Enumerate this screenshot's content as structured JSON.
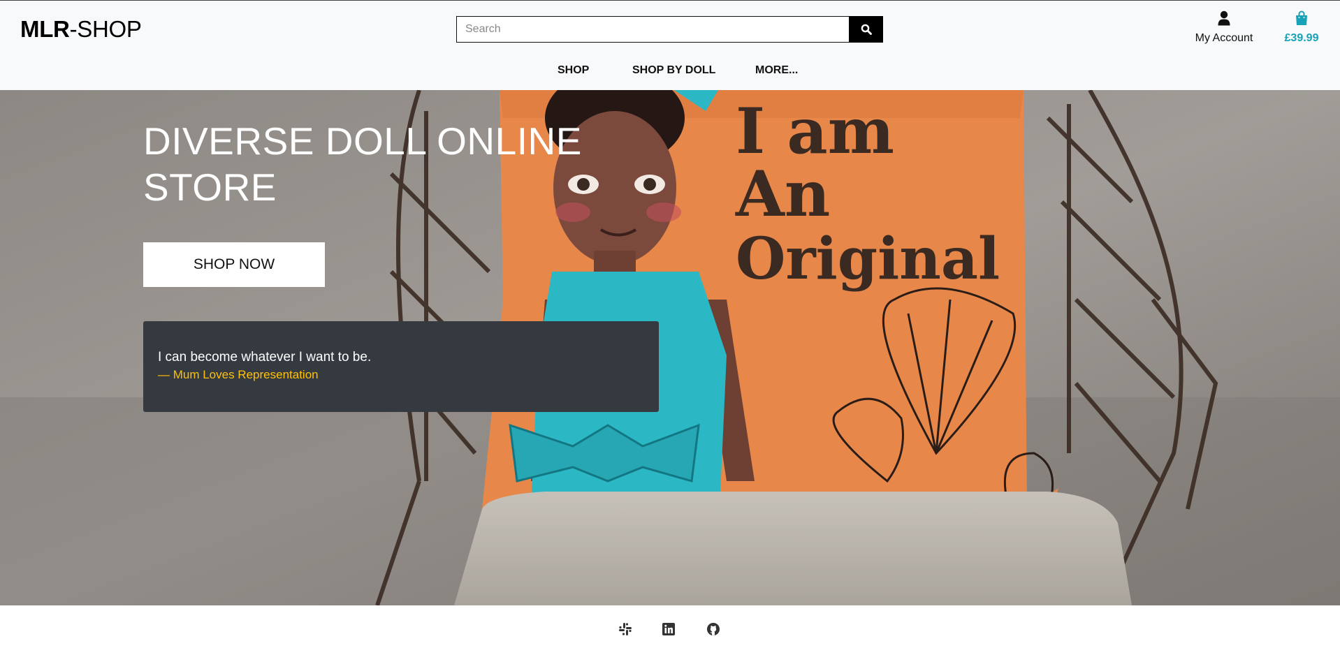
{
  "header": {
    "logo_bold": "MLR",
    "logo_rest": "-SHOP",
    "search": {
      "placeholder": "Search",
      "value": "",
      "button_icon": "search-icon"
    },
    "account": {
      "icon": "user-icon",
      "label": "My Account"
    },
    "bag": {
      "icon": "shopping-bag-icon",
      "total": "£39.99",
      "color": "#17a2b8"
    }
  },
  "nav": {
    "items": [
      {
        "label": "SHOP"
      },
      {
        "label": "SHOP BY DOLL"
      },
      {
        "label": "MORE..."
      }
    ]
  },
  "hero": {
    "title": "DIVERSE DOLL ONLINE STORE",
    "button_label": "SHOP NOW",
    "image_text": [
      "I am",
      "An",
      "Original"
    ],
    "quote": {
      "text": "I can become whatever I want to be.",
      "author": "— Mum Loves Representation",
      "author_color": "#ffc107"
    }
  },
  "footer": {
    "social": [
      {
        "icon": "slack-icon"
      },
      {
        "icon": "linkedin-icon"
      },
      {
        "icon": "github-icon"
      }
    ]
  },
  "colors": {
    "header_bg": "#f8f9fa",
    "quote_bg": "#343a40",
    "cushion": "#e8874a",
    "dress": "#2bb8c4"
  }
}
